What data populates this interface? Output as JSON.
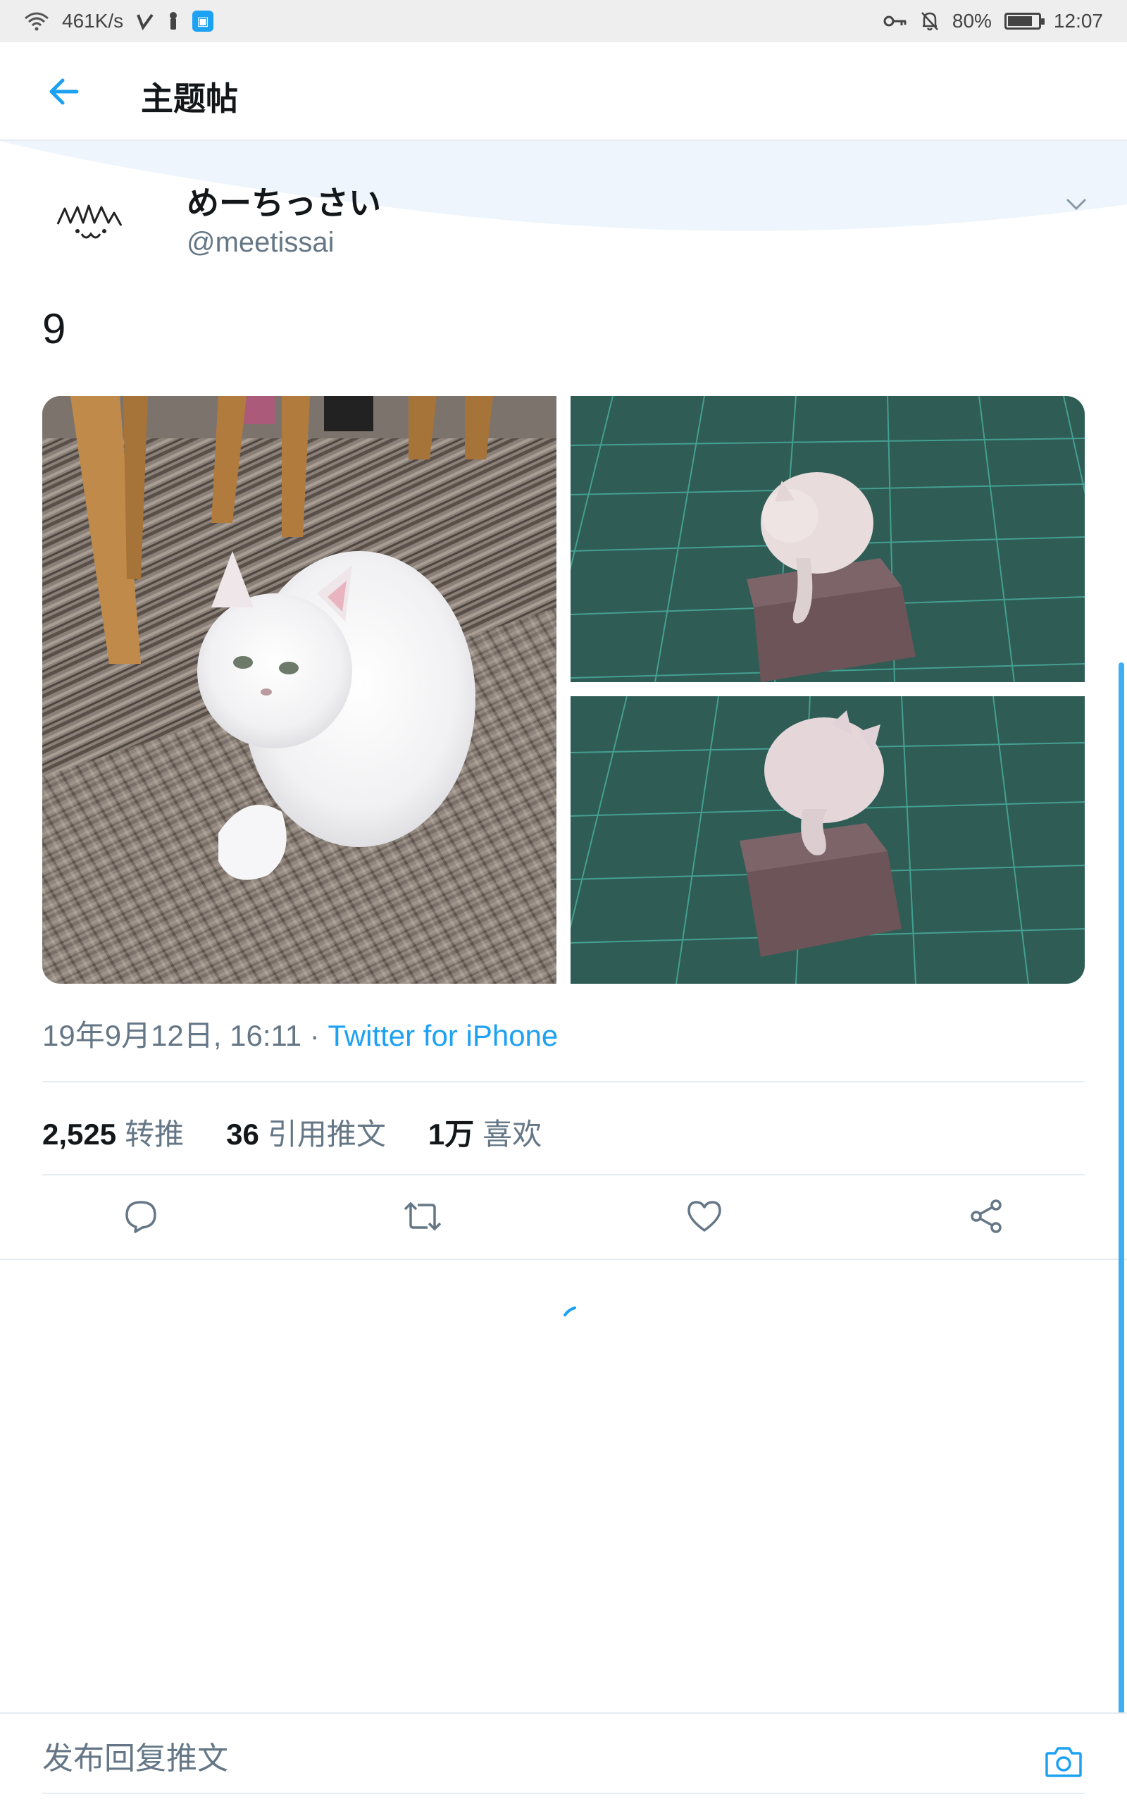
{
  "status_bar": {
    "net_speed": "461K/s",
    "battery_percent": "80%",
    "battery_level": 0.8,
    "time": "12:07",
    "icons": [
      "wifi-icon",
      "signal-icon",
      "download-icon",
      "app-icon",
      "key-icon",
      "bell-off-icon",
      "battery-icon"
    ]
  },
  "header": {
    "title": "主题帖",
    "back_icon": "arrow-left-icon"
  },
  "tweet": {
    "display_name": "めーちっさい",
    "handle": "@meetissai",
    "text": "9",
    "timestamp": "19年9月12日, 16:11",
    "separator": " · ",
    "source": "Twitter for iPhone",
    "stats": {
      "retweets_count": "2,525",
      "retweets_label": "转推",
      "quotes_count": "36",
      "quotes_label": "引用推文",
      "likes_count": "1万",
      "likes_label": "喜欢"
    },
    "actions": [
      "reply-icon",
      "retweet-icon",
      "like-icon",
      "share-icon"
    ]
  },
  "reply_bar": {
    "placeholder": "发布回复推文",
    "camera_icon": "camera-icon"
  },
  "colors": {
    "accent": "#1da1f2",
    "secondary_text": "#657786",
    "primary_text": "#14171a",
    "divider": "#e6ecf0"
  }
}
